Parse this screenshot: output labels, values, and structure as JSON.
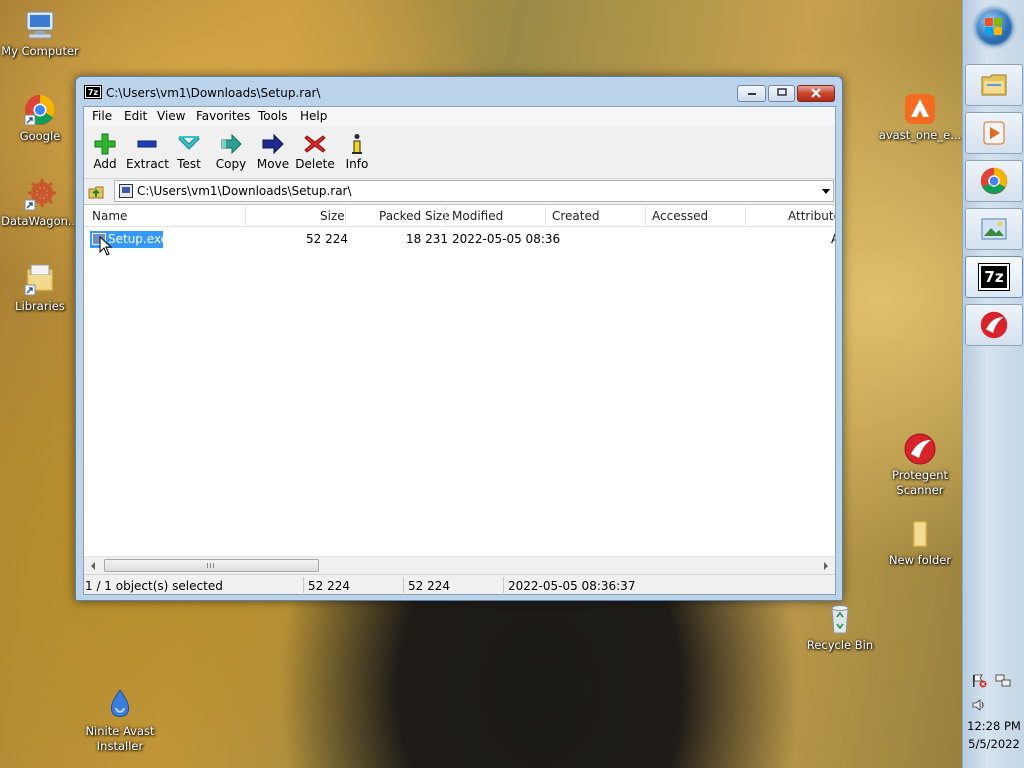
{
  "desktop": {
    "icons_left": [
      {
        "id": "my-computer",
        "label": "My Computer"
      },
      {
        "id": "google",
        "label": "Google"
      },
      {
        "id": "datawagon",
        "label": "DataWagon..."
      },
      {
        "id": "libraries",
        "label": "Libraries"
      },
      {
        "id": "ninite",
        "label": "Ninite Avast Installer"
      }
    ],
    "icons_right": [
      {
        "id": "avast-one",
        "label": "avast_one_e..."
      },
      {
        "id": "protegent",
        "label": "Protegent Scanner"
      },
      {
        "id": "new-folder",
        "label": "New folder"
      },
      {
        "id": "recycle-bin",
        "label": "Recycle Bin"
      }
    ]
  },
  "window": {
    "title": "C:\\Users\\vm1\\Downloads\\Setup.rar\\",
    "app_icon_text": "7z",
    "menu": [
      "File",
      "Edit",
      "View",
      "Favorites",
      "Tools",
      "Help"
    ],
    "toolbar": [
      {
        "label": "Add",
        "icon": "add-icon"
      },
      {
        "label": "Extract",
        "icon": "extract-icon"
      },
      {
        "label": "Test",
        "icon": "test-icon"
      },
      {
        "label": "Copy",
        "icon": "copy-icon"
      },
      {
        "label": "Move",
        "icon": "move-icon"
      },
      {
        "label": "Delete",
        "icon": "delete-icon"
      },
      {
        "label": "Info",
        "icon": "info-icon"
      }
    ],
    "address": "C:\\Users\\vm1\\Downloads\\Setup.rar\\",
    "columns": [
      "Name",
      "Size",
      "Packed Size",
      "Modified",
      "Created",
      "Accessed",
      "Attribute"
    ],
    "rows": [
      {
        "name": "Setup.exe",
        "size": "52 224",
        "packed_size": "18 231",
        "modified": "2022-05-05 08:36",
        "created": "",
        "accessed": "",
        "attributes": "A",
        "selected": true
      }
    ],
    "status": {
      "selection": "1 / 1 object(s) selected",
      "size": "52 224",
      "packed": "52 224",
      "modified": "2022-05-05 08:36:37"
    }
  },
  "taskbar": {
    "pinned": [
      "file-explorer",
      "media-player",
      "chrome",
      "photo-viewer",
      "7-zip",
      "protegent"
    ],
    "pinned_labels": {
      "seven_zip": "7z"
    },
    "clock": {
      "time": "12:28 PM",
      "date": "5/5/2022"
    }
  },
  "colors": {
    "selection": "#3399ff",
    "title_bar": "#bcd3ec",
    "close_button": "#c8452f"
  }
}
